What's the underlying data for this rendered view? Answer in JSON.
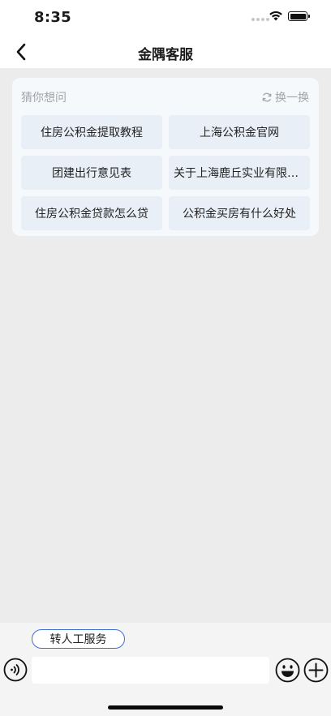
{
  "status_bar": {
    "time": "8:35"
  },
  "nav": {
    "title": "金隅客服"
  },
  "suggestions": {
    "header": "猜你想问",
    "refresh_label": "换一换",
    "items": [
      "住房公积金提取教程",
      "上海公积金官网",
      "团建出行意见表",
      "关于上海鹿丘实业有限公司",
      "住房公积金贷款怎么贷",
      "公积金买房有什么好处"
    ]
  },
  "bottom_bar": {
    "human_service_label": "转人工服务",
    "input_placeholder": ""
  },
  "colors": {
    "accent": "#3f6fd1",
    "card_bg": "#f5f9fc",
    "item_bg": "#e8eff7",
    "page_bg": "#ececec"
  }
}
